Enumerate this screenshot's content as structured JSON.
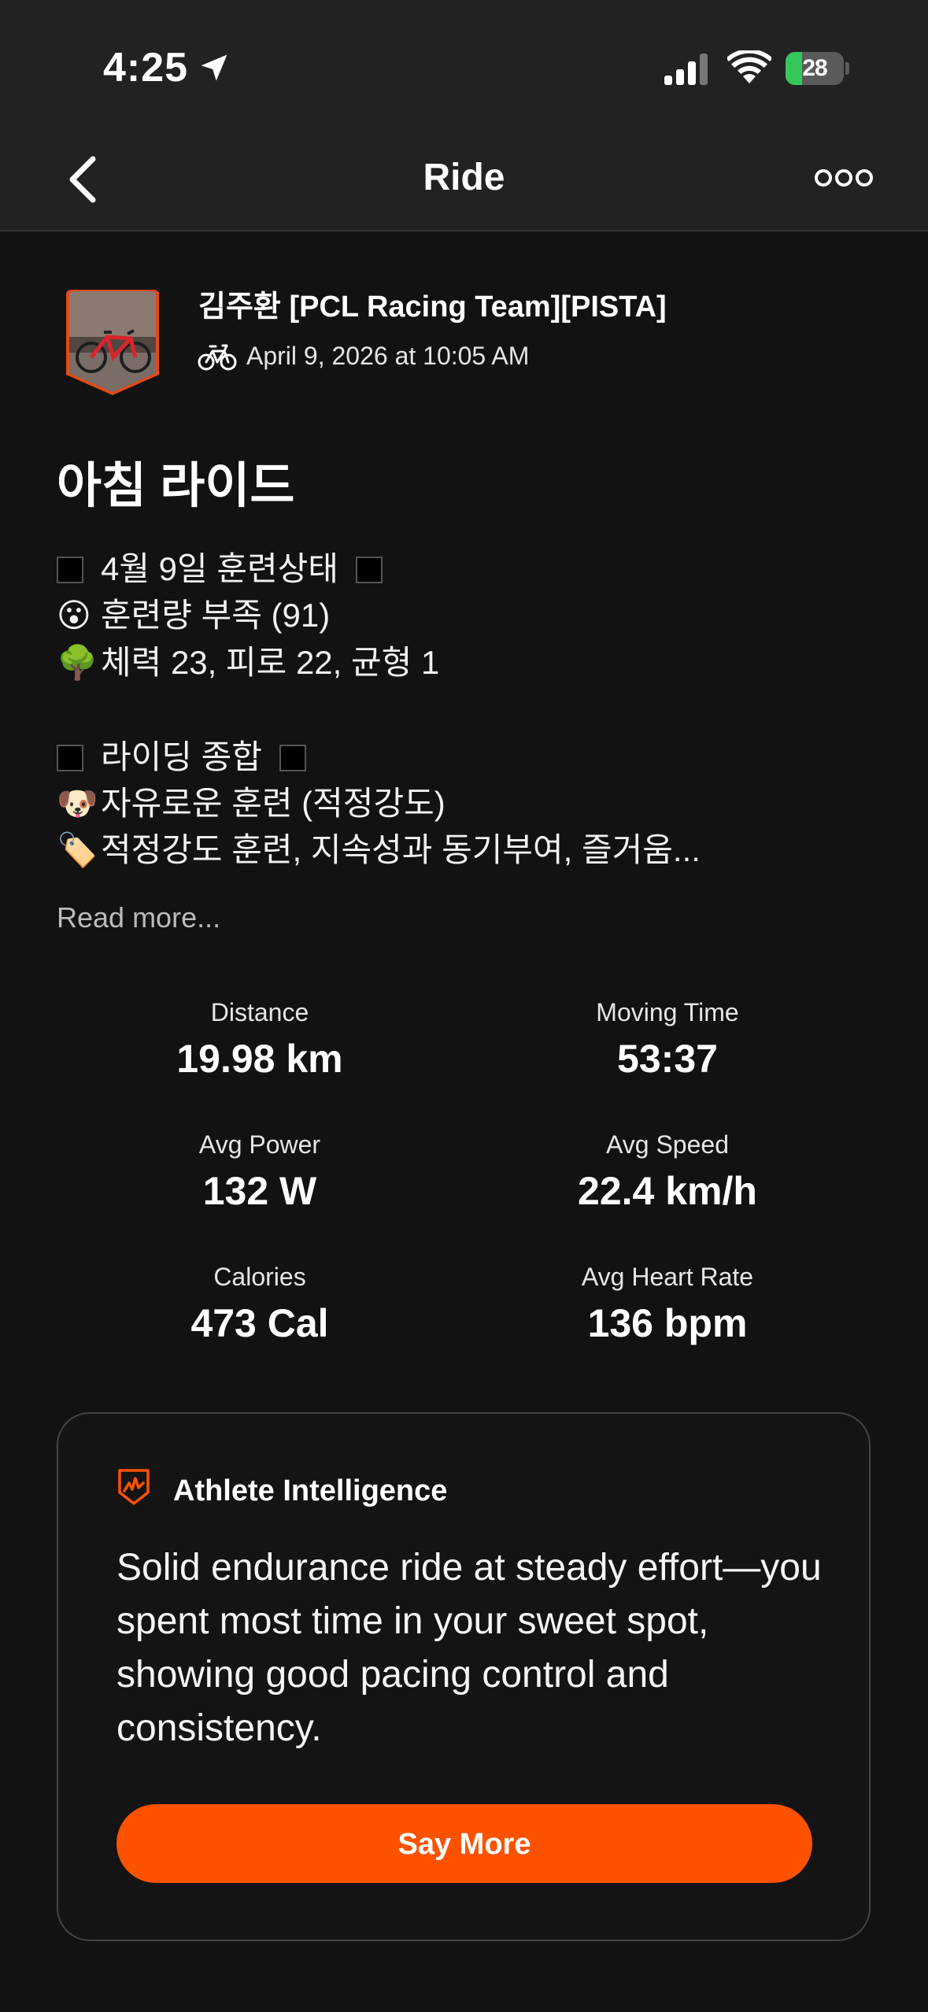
{
  "status_bar": {
    "time": "4:25",
    "battery_level": "28",
    "battery_fraction": 0.28,
    "battery_color": "#34c759"
  },
  "nav": {
    "title": "Ride",
    "back_icon": "chevron-left-icon",
    "more_icon": "more-dots-icon"
  },
  "athlete": {
    "name": "김주환 [PCL Racing Team][PISTA]",
    "activity_type_icon": "bike-icon",
    "date": "April 9, 2026 at 10:05 AM"
  },
  "activity": {
    "title": "아침 라이드",
    "description": [
      {
        "glyph": "",
        "text": "4월 9일 훈련상태",
        "boxed": true
      },
      {
        "glyph": "😮",
        "text": "훈련량 부족 (91)",
        "boxed": false
      },
      {
        "glyph": "🌳",
        "text": "체력 23, 피로 22, 균형 1",
        "boxed": false
      },
      {
        "glyph": "",
        "text": "라이딩 종합",
        "boxed": true
      },
      {
        "glyph": "🐶",
        "text": "자유로운 훈련 (적정강도)",
        "boxed": false
      },
      {
        "glyph": "🏷️",
        "text": "적정강도 훈련, 지속성과 동기부여, 즐거움...",
        "boxed": false
      }
    ],
    "read_more": "Read more..."
  },
  "stats": [
    {
      "label": "Distance",
      "value": "19.98 km"
    },
    {
      "label": "Moving Time",
      "value": "53:37"
    },
    {
      "label": "Avg Power",
      "value": "132 W"
    },
    {
      "label": "Avg Speed",
      "value": "22.4 km/h"
    },
    {
      "label": "Calories",
      "value": "473 Cal"
    },
    {
      "label": "Avg Heart Rate",
      "value": "136 bpm"
    }
  ],
  "athlete_intelligence": {
    "title": "Athlete Intelligence",
    "summary": "Solid endurance ride at steady effort—you spent most time in your sweet spot, showing good pacing control and consistency.",
    "button_label": "Say More",
    "accent_color": "#fc5200"
  }
}
